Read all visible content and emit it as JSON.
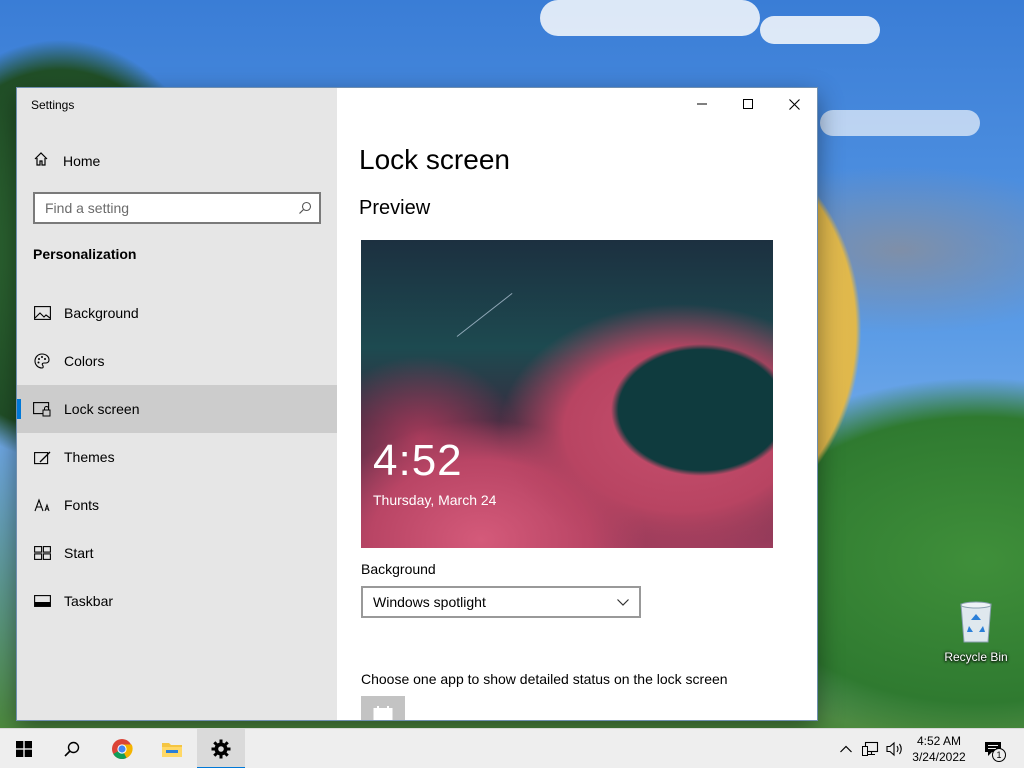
{
  "window": {
    "title": "Settings"
  },
  "sidebar": {
    "home_label": "Home",
    "search_placeholder": "Find a setting",
    "section_header": "Personalization",
    "items": [
      {
        "label": "Background",
        "icon": "picture-icon"
      },
      {
        "label": "Colors",
        "icon": "palette-icon"
      },
      {
        "label": "Lock screen",
        "icon": "lock-screen-icon",
        "active": true
      },
      {
        "label": "Themes",
        "icon": "themes-icon"
      },
      {
        "label": "Fonts",
        "icon": "fonts-icon"
      },
      {
        "label": "Start",
        "icon": "start-icon"
      },
      {
        "label": "Taskbar",
        "icon": "taskbar-icon"
      }
    ]
  },
  "content": {
    "page_title": "Lock screen",
    "preview_title": "Preview",
    "preview": {
      "time": "4:52",
      "date": "Thursday, March 24"
    },
    "background_label": "Background",
    "background_value": "Windows spotlight",
    "status_label": "Choose one app to show detailed status on the lock screen"
  },
  "desktop": {
    "recycle_bin_label": "Recycle Bin"
  },
  "taskbar": {
    "time": "4:52 AM",
    "date": "3/24/2022",
    "notification_count": "1"
  },
  "colors": {
    "accent": "#0078d7",
    "sidebar_bg": "#e6e6e6",
    "active_item_bg": "#cccccc",
    "taskbar_bg": "#eeeeee"
  }
}
